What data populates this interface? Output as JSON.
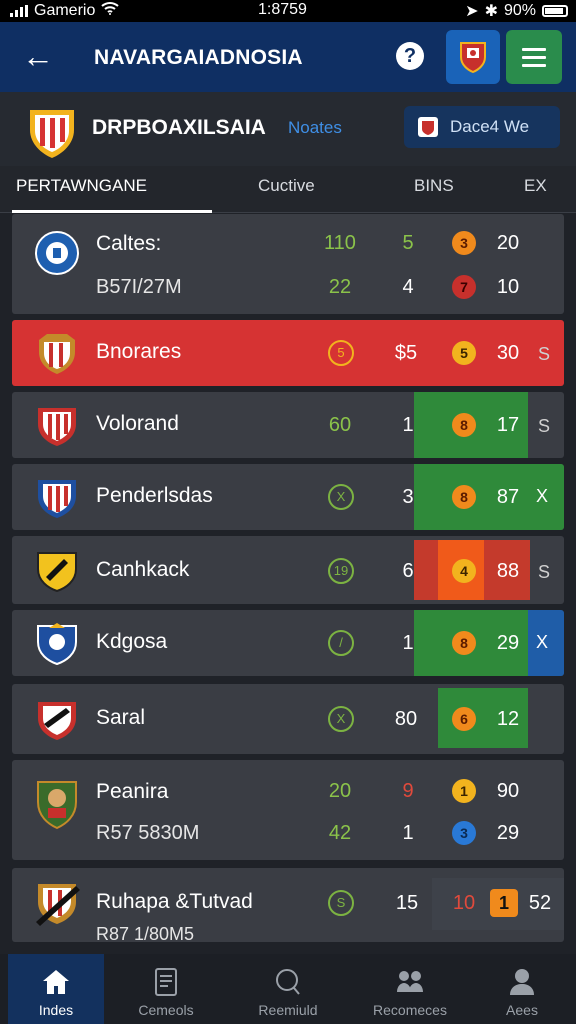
{
  "status": {
    "carrier": "Gamerio",
    "time": "1:8759",
    "battery": "90%"
  },
  "appbar": {
    "title": "NAVARGAIADNOSIA",
    "help": "?",
    "crest_icon": "club-crest-icon",
    "menu_icon": "menu-icon"
  },
  "league": {
    "name": "DRPBOAXILSAIA",
    "link": "Noates",
    "button": "Dace4 We"
  },
  "tabs": [
    "PERTAWNGANE",
    "Cuctive",
    "BINS",
    "EX"
  ],
  "rows": [
    {
      "name": "Caltes:",
      "sub": "B57I/27M",
      "a": "110",
      "b": "22",
      "c": "5",
      "d": "4",
      "e": "3",
      "f": "7",
      "g": "20",
      "h": "10"
    },
    {
      "name": "Bnorares",
      "a": "5",
      "c": "$5",
      "e": "5",
      "g": "30",
      "trail": "S"
    },
    {
      "name": "Volorand",
      "a": "60",
      "c": "1",
      "e": "8",
      "g": "17",
      "trail": "S"
    },
    {
      "name": "Penderlsdas",
      "a": "X",
      "c": "3",
      "e": "8",
      "g": "87",
      "trail": "X"
    },
    {
      "name": "Canhkack",
      "a": "19",
      "c": "6",
      "e": "4",
      "g": "88",
      "trail": "S"
    },
    {
      "name": "Kdgosa",
      "a": "/",
      "c": "1",
      "e": "8",
      "g": "29",
      "trail": "X"
    },
    {
      "name": "Saral",
      "a": "X",
      "c": "80",
      "e": "6",
      "g": "12"
    },
    {
      "name": "Peanira",
      "sub": "R57 5830M",
      "a": "20",
      "b": "42",
      "c": "9",
      "d": "1",
      "e": "1",
      "f": "3",
      "g": "90",
      "h": "29"
    },
    {
      "name": "Ruhapa &Tutvad",
      "sub": "R87 1/80M5",
      "a": "S",
      "c": "15",
      "e": "10",
      "f": "1",
      "g": "52"
    }
  ],
  "nav": [
    "Indes",
    "Cemeols",
    "Reemiuld",
    "Recomeces",
    "Aees"
  ],
  "colors": {
    "appbar": "#0f2f63",
    "highlight": "#d63333",
    "win": "#2f8a3a",
    "loss": "#1f5da8"
  }
}
